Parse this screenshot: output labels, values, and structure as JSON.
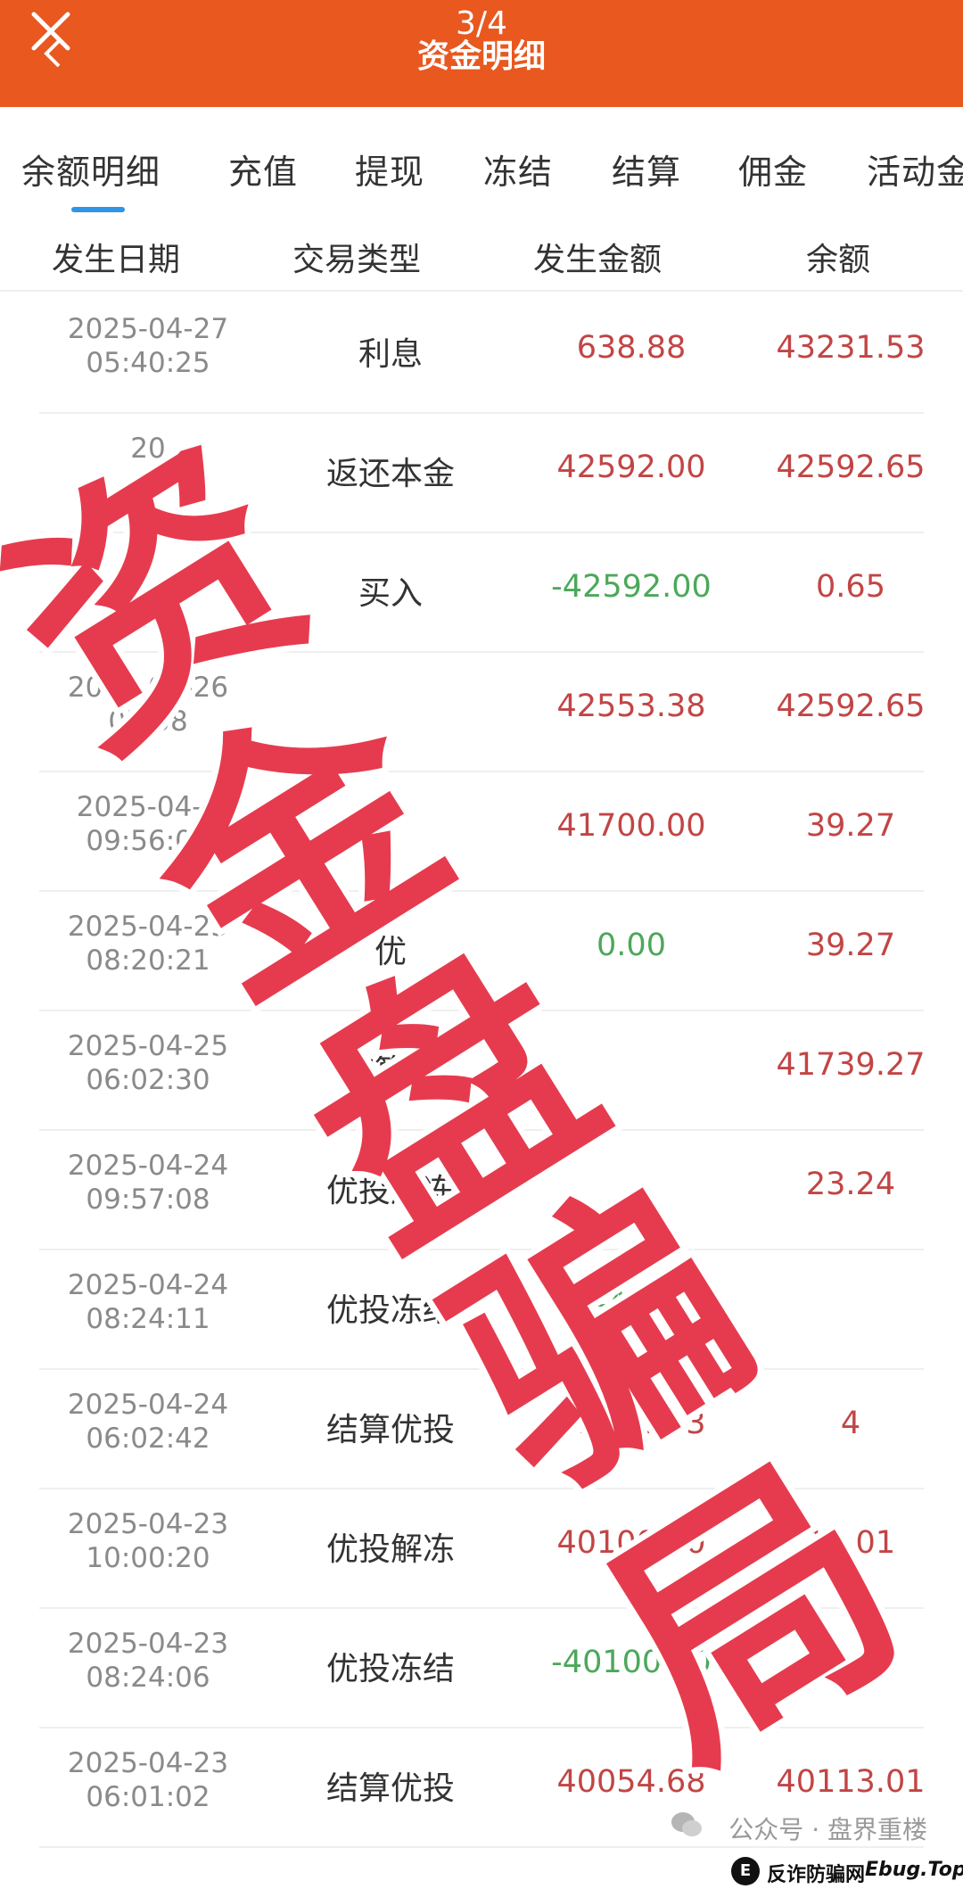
{
  "header": {
    "page_counter": "3/4",
    "title": "资金明细",
    "background_color": "#e8581f"
  },
  "tabs": [
    {
      "label": "余额明细",
      "active": true
    },
    {
      "label": "充值",
      "active": false
    },
    {
      "label": "提现",
      "active": false
    },
    {
      "label": "冻结",
      "active": false
    },
    {
      "label": "结算",
      "active": false
    },
    {
      "label": "佣金",
      "active": false
    },
    {
      "label": "活动金",
      "active": false
    }
  ],
  "table": {
    "columns": [
      "发生日期",
      "交易类型",
      "发生金额",
      "余额"
    ],
    "rows": [
      {
        "date": "2025-04-27",
        "time": "05:40:25",
        "type": "利息",
        "amount": "638.88",
        "balance": "43231.53"
      },
      {
        "date": "20",
        "time": "",
        "type": "返还本金",
        "amount": "42592.00",
        "balance": "42592.65"
      },
      {
        "date": "",
        "time": "",
        "type": "买入",
        "amount": "-42592.00",
        "balance": "0.65"
      },
      {
        "date": "2025-04-26",
        "time": "05:58",
        "type": "",
        "amount": "42553.38",
        "balance": "42592.65"
      },
      {
        "date": "2025-04-2",
        "time": "09:56:07",
        "type": "",
        "amount": "41700.00",
        "balance": "39.27"
      },
      {
        "date": "2025-04-25",
        "time": "08:20:21",
        "type": "优",
        "amount": "0.00",
        "balance": "39.27"
      },
      {
        "date": "2025-04-25",
        "time": "06:02:30",
        "type": "结算优",
        "amount": "",
        "balance": "41739.27"
      },
      {
        "date": "2025-04-24",
        "time": "09:57:08",
        "type": "优投解冻",
        "amount": "",
        "balance": "23.24"
      },
      {
        "date": "2025-04-24",
        "time": "08:24:11",
        "type": "优投冻结",
        "amount": "-410",
        "balance": ""
      },
      {
        "date": "2025-04-24",
        "time": "06:02:42",
        "type": "结算优投",
        "amount": "41010.23",
        "balance": "4"
      },
      {
        "date": "2025-04-23",
        "time": "10:00:20",
        "type": "优投解冻",
        "amount": "40100.00",
        "balance": "13.01"
      },
      {
        "date": "2025-04-23",
        "time": "08:24:06",
        "type": "优投冻结",
        "amount": "-40100.00",
        "balance": "13.01"
      },
      {
        "date": "2025-04-23",
        "time": "06:01:02",
        "type": "结算优投",
        "amount": "40054.68",
        "balance": "40113.01"
      }
    ],
    "positive_color": "#c24545",
    "negative_color": "#4ca85a"
  },
  "stamp": {
    "chars": [
      "资",
      "金",
      "盘",
      "骗",
      "局"
    ],
    "color": "#e63b4e"
  },
  "watermark": {
    "text": "公众号 · 盘界重楼"
  },
  "footer_badge": {
    "logo": "E",
    "label": "反诈防骗网",
    "domain": "Ebug.Top"
  }
}
